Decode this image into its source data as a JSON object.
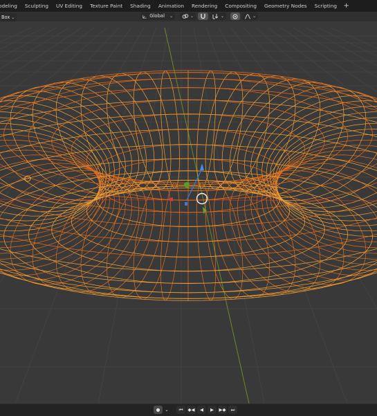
{
  "workspace_tabs": [
    "odeling",
    "Sculpting",
    "UV Editing",
    "Texture Paint",
    "Shading",
    "Animation",
    "Rendering",
    "Compositing",
    "Geometry Nodes",
    "Scripting"
  ],
  "add_tab_label": "+",
  "viewport_header": {
    "select_mode_label": "Box",
    "transform_orientation": "Global"
  },
  "icons": {
    "orientation": "orientation-icon",
    "pivot": "pivot-link-icon",
    "snap": "snap-magnet-icon",
    "snap_target": "snap-increment-icon",
    "proportional": "proportional-editing-icon",
    "falloff": "falloff-curve-icon",
    "record": "record-icon",
    "jump_start": "jump-start-icon",
    "jump_keyframe_back": "keyframe-back-icon",
    "play_reverse": "play-reverse-icon",
    "play": "play-icon",
    "jump_keyframe_forward": "keyframe-forward-icon",
    "jump_end": "jump-end-icon"
  },
  "colors": {
    "background": "#393939",
    "wireframe_selected": "#f2a23a",
    "wireframe_active": "#e56a1a",
    "axis_x": "#c03a3a",
    "axis_y": "#6a9a2a",
    "gizmo_z": "#3a7ae0"
  }
}
